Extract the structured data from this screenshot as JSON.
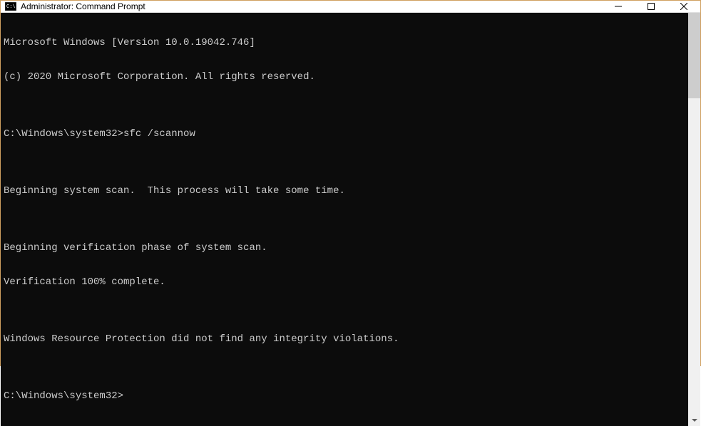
{
  "titlebar": {
    "title": "Administrator: Command Prompt"
  },
  "terminal": {
    "lines": [
      "Microsoft Windows [Version 10.0.19042.746]",
      "(c) 2020 Microsoft Corporation. All rights reserved.",
      "",
      "C:\\Windows\\system32>sfc /scannow",
      "",
      "Beginning system scan.  This process will take some time.",
      "",
      "Beginning verification phase of system scan.",
      "Verification 100% complete.",
      "",
      "Windows Resource Protection did not find any integrity violations.",
      "",
      "C:\\Windows\\system32>"
    ]
  }
}
